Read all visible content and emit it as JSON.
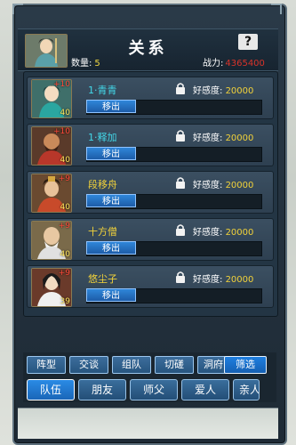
{
  "header": {
    "title": "关系",
    "help": "?",
    "count_label": "数量:",
    "count_value": "5",
    "power_label": "战力:",
    "power_value": "4365400"
  },
  "rows": [
    {
      "name": "1·青青",
      "stat_top": "+10",
      "stat_bot": "40",
      "fav_label": "好感度:",
      "fav_value": "20000",
      "move": "移出",
      "name_color": "cyan"
    },
    {
      "name": "1·释加",
      "stat_top": "+10",
      "stat_bot": "40",
      "fav_label": "好感度:",
      "fav_value": "20000",
      "move": "移出",
      "name_color": "cyan"
    },
    {
      "name": "段移舟",
      "stat_top": "+9",
      "stat_bot": "40",
      "fav_label": "好感度:",
      "fav_value": "20000",
      "move": "移出",
      "name_color": "gold"
    },
    {
      "name": "十方僧",
      "stat_top": "+9",
      "stat_bot": "40",
      "fav_label": "好感度:",
      "fav_value": "20000",
      "move": "移出",
      "name_color": "gold"
    },
    {
      "name": "悠尘子",
      "stat_top": "+9",
      "stat_bot": "39",
      "fav_label": "好感度:",
      "fav_value": "20000",
      "move": "移出",
      "name_color": "gold"
    }
  ],
  "filters": [
    "阵型",
    "交谈",
    "组队",
    "切磋",
    "洞府"
  ],
  "sift": "筛选",
  "tabs": [
    "队伍",
    "朋友",
    "师父",
    "爱人",
    "亲人"
  ],
  "colors": {
    "cyan": "#43d7e8",
    "gold": "#f2d23a",
    "power": "#d8332a",
    "accent": "#1f7fe0"
  }
}
